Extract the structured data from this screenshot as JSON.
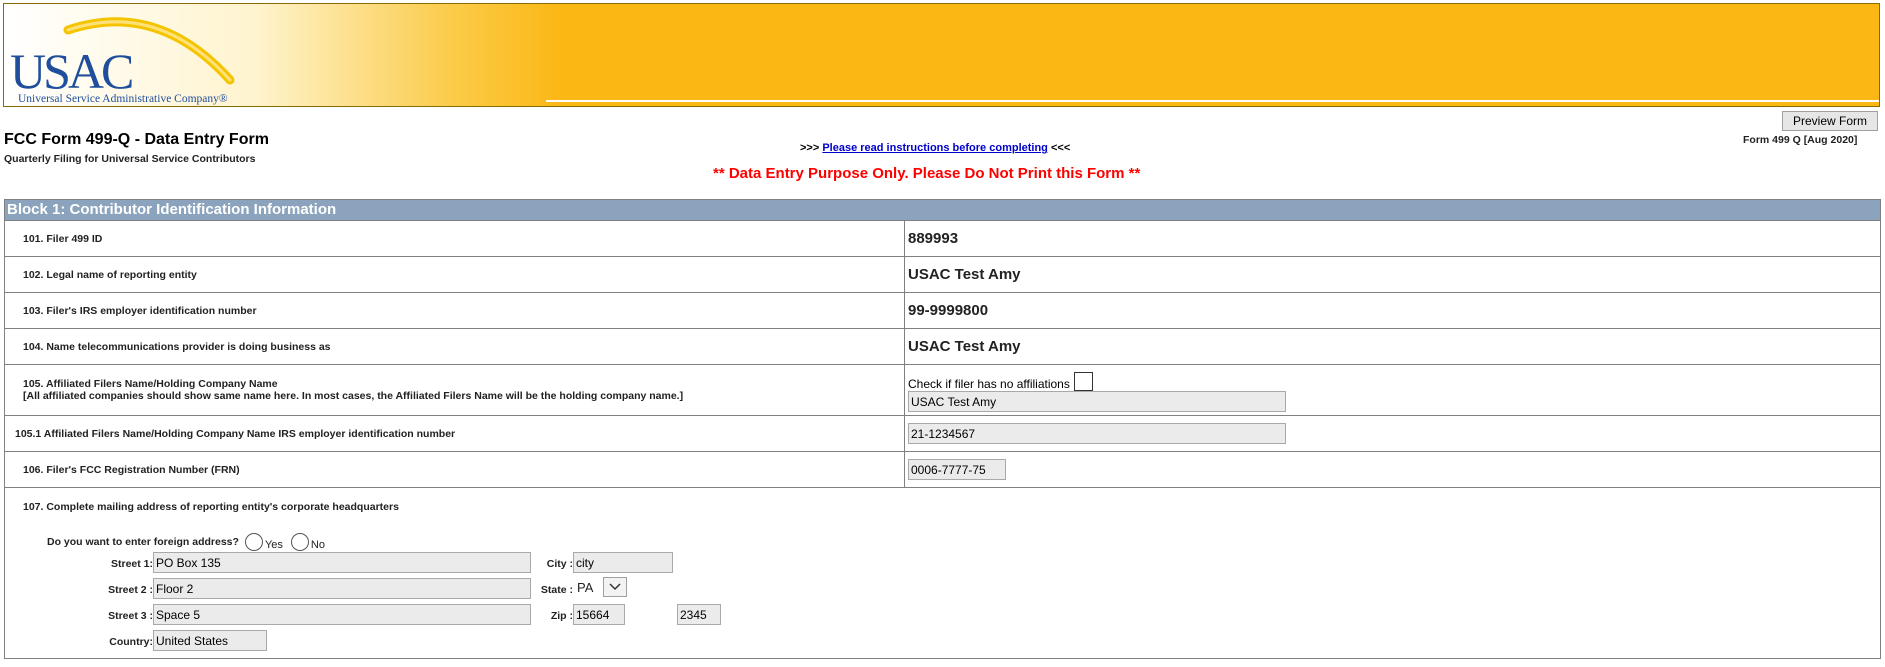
{
  "banner": {
    "logo_text": "USAC",
    "logo_tagline": "Universal Service Administrative Company®"
  },
  "header": {
    "title": "FCC Form 499-Q - Data Entry Form",
    "subtitle": "Quarterly Filing for Universal Service Contributors",
    "instructions_prefix": ">>>",
    "instructions_link": "Please read instructions before completing",
    "instructions_suffix": "<<<",
    "warning": "** Data Entry Purpose Only. Please Do Not Print this Form **",
    "preview_button": "Preview Form",
    "form_version": "Form 499 Q [Aug 2020]"
  },
  "block1": {
    "title": "Block 1: Contributor Identification Information",
    "rows": {
      "r101": {
        "label": "101. Filer 499 ID",
        "value": "889993"
      },
      "r102": {
        "label": "102. Legal name of reporting entity",
        "value": "USAC Test Amy"
      },
      "r103": {
        "label": "103. Filer's IRS employer identification number",
        "value": "99-9999800"
      },
      "r104": {
        "label": "104. Name telecommunications provider is doing business as",
        "value": "USAC Test Amy"
      },
      "r105": {
        "label": "105. Affiliated Filers Name/Holding Company Name",
        "note": "[All affiliated companies should show same name here. In most cases, the Affiliated Filers Name will be the holding company name.]",
        "checkbox_label": "Check if filer has no affiliations",
        "value": "USAC Test Amy"
      },
      "r105_1": {
        "label": "105.1 Affiliated Filers Name/Holding Company Name IRS employer identification number",
        "value": "21-1234567"
      },
      "r106": {
        "label": "106. Filer's FCC Registration Number (FRN)",
        "value": "0006-7777-75"
      },
      "r107": {
        "label": "107. Complete mailing address of reporting entity's corporate headquarters",
        "foreign_question": "Do you want to enter foreign address?",
        "yes_label": "Yes",
        "no_label": "No",
        "street1_label": "Street 1:",
        "street1": "PO Box 135",
        "street2_label": "Street 2 :",
        "street2": "Floor 2",
        "street3_label": "Street 3 :",
        "street3": "Space 5",
        "country_label": "Country:",
        "country": "United States",
        "city_label": "City :",
        "city": "city",
        "state_label": "State :",
        "state": "PA",
        "zip_label": "Zip :",
        "zip": "15664",
        "zip4": "2345"
      }
    }
  }
}
